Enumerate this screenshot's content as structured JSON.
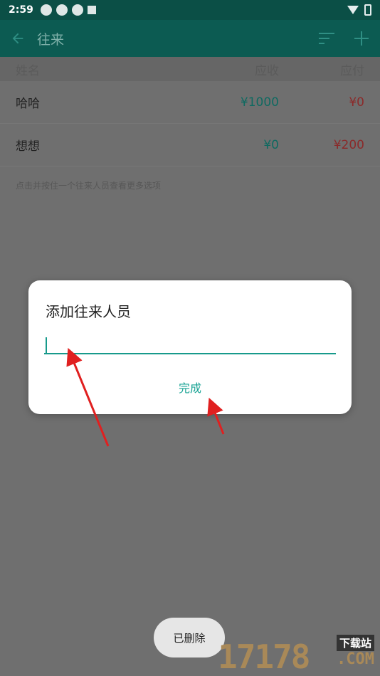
{
  "status": {
    "time": "2:59"
  },
  "appbar": {
    "title": "往来",
    "back_icon": "arrow-left-icon",
    "sort_icon": "sort-icon",
    "add_icon": "plus-icon"
  },
  "table": {
    "headers": [
      "姓名",
      "应收",
      "应付"
    ],
    "rows": [
      {
        "name": "哈哈",
        "receivable": "¥1000",
        "payable": "¥0"
      },
      {
        "name": "想想",
        "receivable": "¥0",
        "payable": "¥200"
      }
    ]
  },
  "hint": "点击并按住一个往来人员查看更多选项",
  "dialog": {
    "title": "添加往来人员",
    "input_value": "",
    "input_placeholder": "",
    "done_label": "完成"
  },
  "toast": {
    "text": "已删除"
  },
  "watermark": {
    "main": "17178",
    "sub": "下载站",
    "suffix": ".COM"
  },
  "colors": {
    "primary_dark": "#0b4f46",
    "primary": "#0c5b52",
    "accent": "#18a394",
    "receivable": "#0f6a61",
    "payable": "#8b2a2a",
    "annotation": "#e02020"
  }
}
